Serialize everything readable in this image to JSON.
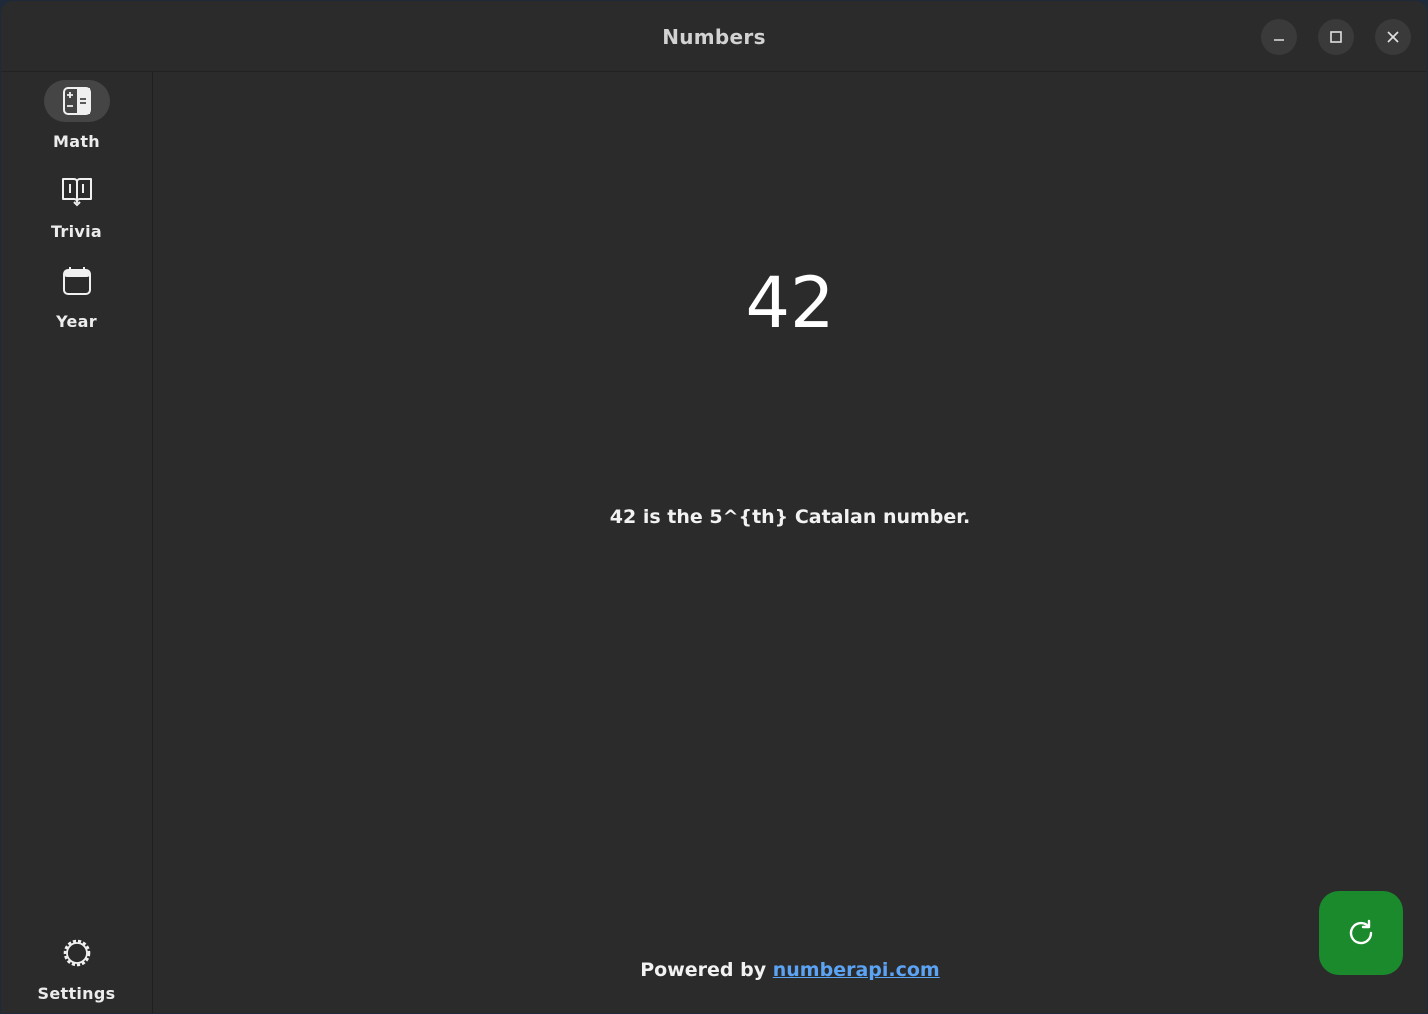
{
  "window": {
    "title": "Numbers"
  },
  "sidebar": {
    "items": [
      {
        "label": "Math",
        "icon": "calculator-icon",
        "active": true
      },
      {
        "label": "Trivia",
        "icon": "book-icon",
        "active": false
      },
      {
        "label": "Year",
        "icon": "calendar-icon",
        "active": false
      }
    ],
    "settings": {
      "label": "Settings",
      "icon": "gear-icon"
    }
  },
  "main": {
    "number": "42",
    "fact": "42 is the 5^{th} Catalan number.",
    "footer_prefix": "Powered by ",
    "footer_link": "numberapi.com"
  },
  "actions": {
    "refresh_icon": "refresh-icon"
  },
  "colors": {
    "background": "#2b2b2b",
    "link": "#5ba3f5",
    "fab": "#1a8a2c",
    "active_pill": "#454545"
  }
}
